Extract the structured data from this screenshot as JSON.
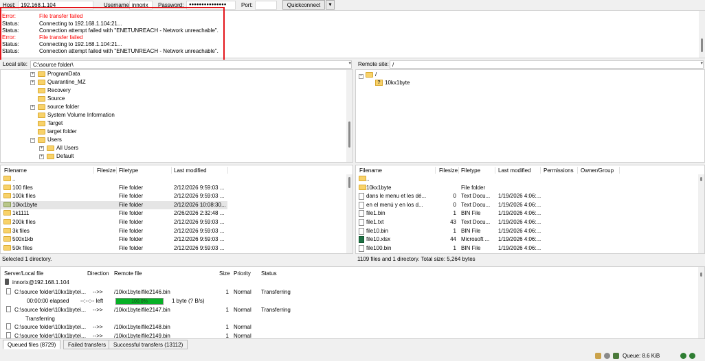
{
  "quickconnect": {
    "host_label": "Host:",
    "host_value": "192.168.1.104",
    "username_label": "Username:",
    "username_value": "innorix",
    "password_label": "Password:",
    "password_value": "●●●●●●●●●●●●●●●",
    "port_label": "Port:",
    "port_value": "",
    "button_label": "Quickconnect"
  },
  "log": {
    "lines": [
      {
        "type": "Error:",
        "text": "File transfer failed",
        "kind": "error"
      },
      {
        "type": "Status:",
        "text": "Connecting to 192.168.1.104:21...",
        "kind": "status"
      },
      {
        "type": "Status:",
        "text": "Connection attempt failed with \"ENETUNREACH - Network unreachable\".",
        "kind": "status"
      },
      {
        "type": "Error:",
        "text": "File transfer failed",
        "kind": "error"
      },
      {
        "type": "Status:",
        "text": "Connecting to 192.168.1.104:21...",
        "kind": "status"
      },
      {
        "type": "Status:",
        "text": "Connection attempt failed with \"ENETUNREACH - Network unreachable\".",
        "kind": "status"
      }
    ]
  },
  "local_site": {
    "label": "Local site:",
    "path": "C:\\source folder\\",
    "tree": [
      {
        "name": "ProgramData",
        "expander": true,
        "indent": 0
      },
      {
        "name": "Quarantine_MZ",
        "expander": true,
        "indent": 0
      },
      {
        "name": "Recovery",
        "expander": false,
        "indent": 0
      },
      {
        "name": "Source",
        "expander": false,
        "indent": 0
      },
      {
        "name": "source folder",
        "expander": true,
        "indent": 0
      },
      {
        "name": "System Volume Information",
        "expander": false,
        "indent": 0
      },
      {
        "name": "Target",
        "expander": false,
        "indent": 0
      },
      {
        "name": "target folder",
        "expander": false,
        "indent": 0
      },
      {
        "name": "Users",
        "expander": true,
        "indent": 0,
        "expanded": true
      },
      {
        "name": "All Users",
        "expander": true,
        "indent": 1
      },
      {
        "name": "Default",
        "expander": true,
        "indent": 1
      }
    ],
    "columns": [
      "Filename",
      "Filesize",
      "Filetype",
      "Last modified"
    ],
    "files": [
      {
        "name": "..",
        "size": "",
        "type": "",
        "modified": "",
        "icon": "folder"
      },
      {
        "name": "100 files",
        "size": "",
        "type": "File folder",
        "modified": "2/12/2026 9:59:03 ...",
        "icon": "folder"
      },
      {
        "name": "100k files",
        "size": "",
        "type": "File folder",
        "modified": "2/12/2026 9:59:03 ...",
        "icon": "folder"
      },
      {
        "name": "10kx1byte",
        "size": "",
        "type": "File folder",
        "modified": "2/12/2026 10:08:30...",
        "icon": "folder-green",
        "selected": true
      },
      {
        "name": "1k1111",
        "size": "",
        "type": "File folder",
        "modified": "2/26/2026 2:32:48 ...",
        "icon": "folder"
      },
      {
        "name": "200k files",
        "size": "",
        "type": "File folder",
        "modified": "2/12/2026 9:59:03 ...",
        "icon": "folder"
      },
      {
        "name": "3k files",
        "size": "",
        "type": "File folder",
        "modified": "2/12/2026 9:59:03 ...",
        "icon": "folder"
      },
      {
        "name": "500x1kb",
        "size": "",
        "type": "File folder",
        "modified": "2/12/2026 9:59:03 ...",
        "icon": "folder"
      },
      {
        "name": "50k files",
        "size": "",
        "type": "File folder",
        "modified": "2/12/2026 9:59:03 ...",
        "icon": "folder"
      }
    ],
    "status": "Selected 1 directory."
  },
  "remote_site": {
    "label": "Remote site:",
    "path": "/",
    "tree": [
      {
        "name": "/",
        "icon": "folder"
      },
      {
        "name": "10kx1byte",
        "icon": "question-folder"
      }
    ],
    "columns": [
      "Filename",
      "Filesize",
      "Filetype",
      "Last modified",
      "Permissions",
      "Owner/Group"
    ],
    "files": [
      {
        "name": "..",
        "size": "",
        "type": "",
        "modified": "",
        "icon": "folder"
      },
      {
        "name": "10kx1byte",
        "size": "",
        "type": "File folder",
        "modified": "",
        "icon": "folder"
      },
      {
        "name": "dans le menu et les dé...",
        "size": "0",
        "type": "Text Docu...",
        "modified": "1/19/2026 4:06:...",
        "icon": "file"
      },
      {
        "name": "en el menú y en los d...",
        "size": "0",
        "type": "Text Docu...",
        "modified": "1/19/2026 4:06:...",
        "icon": "file"
      },
      {
        "name": "file1.bin",
        "size": "1",
        "type": "BIN File",
        "modified": "1/19/2026 4:06:...",
        "icon": "file"
      },
      {
        "name": "file1.txt",
        "size": "43",
        "type": "Text Docu...",
        "modified": "1/19/2026 4:06:...",
        "icon": "file"
      },
      {
        "name": "file10.bin",
        "size": "1",
        "type": "BIN File",
        "modified": "1/19/2026 4:06:...",
        "icon": "file"
      },
      {
        "name": "file10.xlsx",
        "size": "44",
        "type": "Microsoft ...",
        "modified": "1/19/2026 4:06:...",
        "icon": "xlsx"
      },
      {
        "name": "file100.bin",
        "size": "1",
        "type": "BIN File",
        "modified": "1/19/2026 4:06:...",
        "icon": "file"
      }
    ],
    "status": "1109 files and 1 directory. Total size: 5,264 bytes"
  },
  "queue": {
    "columns": [
      "Server/Local file",
      "Direction",
      "Remote file",
      "Size",
      "Priority",
      "Status"
    ],
    "server": "innorix@192.168.1.104",
    "items": [
      {
        "local": "C:\\source folder\\10kx1byte\\...",
        "direction": "-->>",
        "remote": "/10kx1byte/file2146.bin",
        "size": "1",
        "priority": "Normal",
        "status": "Transferring"
      },
      {
        "local": "C:\\source folder\\10kx1byte\\...",
        "direction": "-->>",
        "remote": "/10kx1byte/file2147.bin",
        "size": "1",
        "priority": "Normal",
        "status": "Transferring"
      },
      {
        "local": "C:\\source folder\\10kx1byte\\...",
        "direction": "-->>",
        "remote": "/10kx1byte/file2148.bin",
        "size": "1",
        "priority": "Normal",
        "status": ""
      },
      {
        "local": "C:\\source folder\\10kx1byte\\...",
        "direction": "-->>",
        "remote": "/10kx1byte/file2149.bin",
        "size": "1",
        "priority": "Normal",
        "status": ""
      }
    ],
    "progress": {
      "elapsed": "00:00:00 elapsed",
      "left": "--:--:-- left",
      "percent_label": "100.0%",
      "fraction": 1.0,
      "rate": "1 byte (? B/s)"
    },
    "sub_status": "Transferring"
  },
  "tabs": [
    {
      "label": "Queued files (8729)",
      "active": true
    },
    {
      "label": "Failed transfers",
      "active": false
    },
    {
      "label": "Successful transfers (13112)",
      "active": false
    }
  ],
  "statusbar": {
    "queue_label": "Queue: 8.6 KiB"
  },
  "colors": {
    "error": "#ff0000",
    "highlight": "#e3141a",
    "progress": "#06b025",
    "folder": "#f8d26a"
  }
}
